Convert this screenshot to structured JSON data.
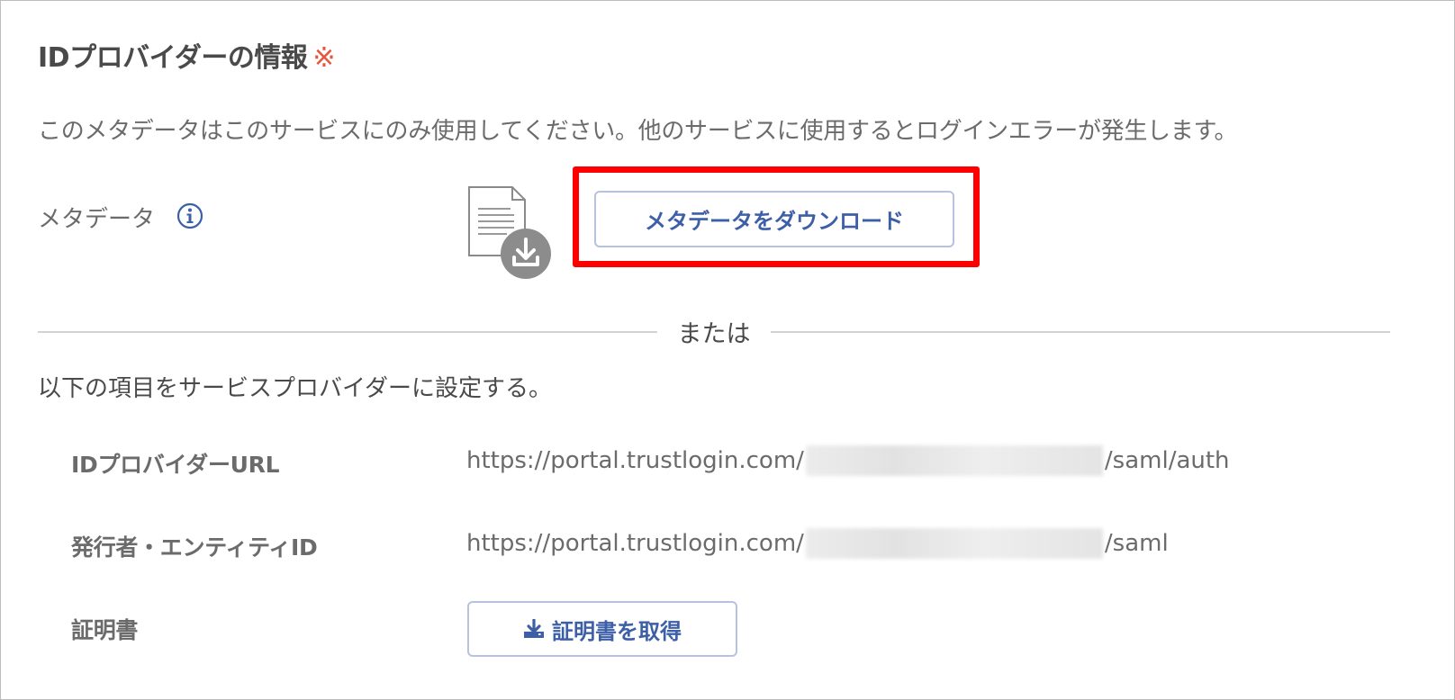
{
  "section": {
    "title": "IDプロバイダーの情報",
    "required_mark": "※",
    "warning": "このメタデータはこのサービスにのみ使用してください。他のサービスに使用するとログインエラーが発生します。"
  },
  "metadata": {
    "label": "メタデータ",
    "info_icon": "info-circle-icon",
    "file_icon": "file-download-icon",
    "download_button_label": "メタデータをダウンロード"
  },
  "divider": {
    "or_text": "または"
  },
  "instructions": "以下の項目をサービスプロバイダーに設定する。",
  "fields": {
    "idp_url": {
      "label": "IDプロバイダーURL",
      "value_prefix": "https://portal.trustlogin.com/",
      "value_suffix": "/saml/auth"
    },
    "entity_id": {
      "label": "発行者・エンティティID",
      "value_prefix": "https://portal.trustlogin.com/",
      "value_suffix": "/saml"
    },
    "certificate": {
      "label": "証明書",
      "button_label": "証明書を取得",
      "button_icon": "download-icon"
    }
  },
  "colors": {
    "accent": "#3d5fa8",
    "highlight": "#ff0000",
    "required": "#e8553e",
    "text": "#6b6b6b"
  }
}
